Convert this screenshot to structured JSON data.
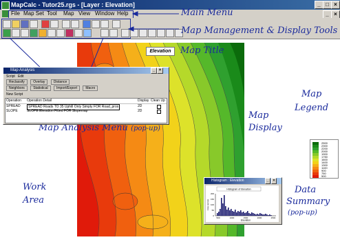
{
  "window": {
    "title": "MapCalc - Tutor25.rgs - [Layer : Elevation]"
  },
  "menu": [
    "File",
    "Map Set",
    "Tool",
    "Map",
    "View",
    "Window",
    "Help"
  ],
  "callouts": {
    "main_menu": "Main Menu",
    "tools": "Map Management & Display Tools",
    "map_title": "Map Title",
    "map_legend_1": "Map",
    "map_legend_2": "Legend",
    "map_display_1": "Map",
    "map_display_2": "Display",
    "analysis": "Map Analysis Menu",
    "analysis_suffix": "(pop-up)",
    "work_1": "Work",
    "work_2": "Area",
    "summary_1": "Data",
    "summary_2": "Summary",
    "summary_3": "(pop-up)"
  },
  "map": {
    "title": "Elevation"
  },
  "analysis_dialog": {
    "title": "Map Analysis",
    "menu": [
      "Script",
      "Edit"
    ],
    "buttons_row1": [
      "Reclassify",
      "Overlay",
      "Distance"
    ],
    "buttons_row2": [
      "Neighbors",
      "Statistical",
      "Import/Export",
      "Macro"
    ],
    "tab": "New Script",
    "headers": [
      "Operation",
      "Operation Detail",
      "Display",
      "Clean Up"
    ],
    "rows": [
      {
        "op": "SPREAD",
        "detail": "SPREAD Roads TO 35 Uphill Only Simply FOR Road_prox",
        "display": "2D"
      },
      {
        "op": "SLOPE",
        "detail": "SLOPE Elevation Fitted FOR Slopemap",
        "display": "2D"
      }
    ]
  },
  "histogram": {
    "title": "Histogram : Elevation",
    "chart_title": "Histogram of Elevation",
    "xlabel": "Elevation",
    "ylabel": "Area (acres)",
    "xticks": [
      "500",
      "1000",
      "1500",
      "2000",
      "2500"
    ],
    "yticks": [
      "0",
      "50",
      "100",
      "150",
      "200"
    ]
  },
  "legend": {
    "labels": [
      "2500",
      "2300",
      "2200",
      "2000",
      "1900",
      "1750",
      "1600",
      "1400",
      "1300",
      "1100",
      "900",
      "750",
      "500"
    ],
    "colors": [
      "#0b6b0b",
      "#1a8a1a",
      "#2fa02f",
      "#55b82a",
      "#88c92a",
      "#b5d92a",
      "#dde22a",
      "#f2d21a",
      "#f5b01a",
      "#f58a14",
      "#f0600f",
      "#e83a0c",
      "#e01a0a"
    ]
  }
}
